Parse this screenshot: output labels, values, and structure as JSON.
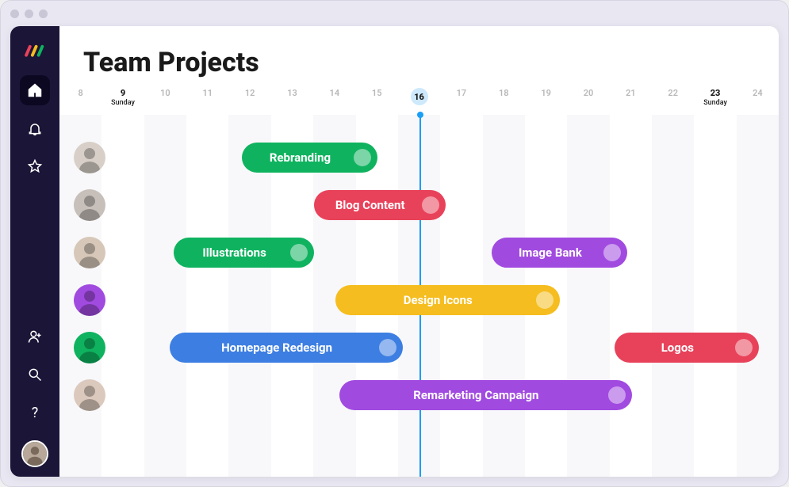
{
  "page": {
    "title": "Team Projects"
  },
  "colors": {
    "green": "#0fb35f",
    "red": "#e8425a",
    "purple": "#a14ae0",
    "yellow": "#f5bd1f",
    "blue": "#3d7ee2"
  },
  "chart_data": {
    "type": "bar",
    "xlabel": "",
    "ylabel": "",
    "x_range": [
      8,
      24
    ],
    "today": 16,
    "highlighted_dates": [
      {
        "day": 9,
        "label": "Sunday"
      },
      {
        "day": 23,
        "label": "Sunday"
      }
    ],
    "series": [
      {
        "row": 0,
        "name": "Rebranding",
        "start": 11.8,
        "end": 15.0,
        "color": "green"
      },
      {
        "row": 1,
        "name": "Blog Content",
        "start": 13.5,
        "end": 16.6,
        "color": "red"
      },
      {
        "row": 2,
        "name": "Illustrations",
        "start": 10.2,
        "end": 13.5,
        "color": "green"
      },
      {
        "row": 2,
        "name": "Image Bank",
        "start": 17.7,
        "end": 20.9,
        "color": "purple"
      },
      {
        "row": 3,
        "name": "Design Icons",
        "start": 14.0,
        "end": 19.3,
        "color": "yellow"
      },
      {
        "row": 4,
        "name": "Homepage Redesign",
        "start": 10.1,
        "end": 15.6,
        "color": "blue"
      },
      {
        "row": 4,
        "name": "Logos",
        "start": 20.6,
        "end": 24.0,
        "color": "red"
      },
      {
        "row": 5,
        "name": "Remarketing Campaign",
        "start": 14.1,
        "end": 21.0,
        "color": "purple"
      }
    ],
    "rows": [
      {
        "avatar_bg": "#d8d0c8"
      },
      {
        "avatar_bg": "#c7c0ba"
      },
      {
        "avatar_bg": "#d6c7b8"
      },
      {
        "avatar_bg": "#a14ae0"
      },
      {
        "avatar_bg": "#0fb35f"
      },
      {
        "avatar_bg": "#dcc9bd"
      }
    ]
  },
  "sidebar": {
    "items": [
      {
        "icon": "home",
        "active": true
      },
      {
        "icon": "bell",
        "active": false
      },
      {
        "icon": "star",
        "active": false
      }
    ],
    "footer_items": [
      {
        "icon": "add-user"
      },
      {
        "icon": "search"
      },
      {
        "icon": "help"
      }
    ],
    "help_glyph": "?"
  }
}
